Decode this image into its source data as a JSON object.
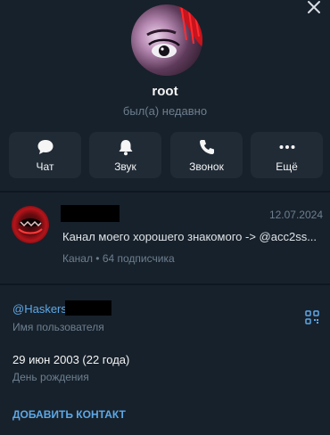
{
  "profile": {
    "name": "root",
    "status": "был(а) недавно"
  },
  "actions": [
    {
      "label": "Чат",
      "icon": "chat-bubble-icon"
    },
    {
      "label": "Звук",
      "icon": "bell-icon"
    },
    {
      "label": "Звонок",
      "icon": "phone-icon"
    },
    {
      "label": "Ещё",
      "icon": "more-dots-icon"
    }
  ],
  "channel": {
    "date": "12.07.2024",
    "description": "Канал моего хорошего знакомого -> @acc2ss...",
    "meta": "Канал • 64 подписчика"
  },
  "info": {
    "username": "@Haskers",
    "username_label": "Имя пользователя",
    "birthday": "29 июн 2003 (22 года)",
    "birthday_label": "День рождения"
  },
  "add_contact": "ДОБАВИТЬ КОНТАКТ",
  "colors": {
    "background": "#17212b",
    "separator": "#0e1621",
    "button": "#202b36",
    "accent": "#5ea8e6",
    "muted": "#6d7f8f"
  }
}
